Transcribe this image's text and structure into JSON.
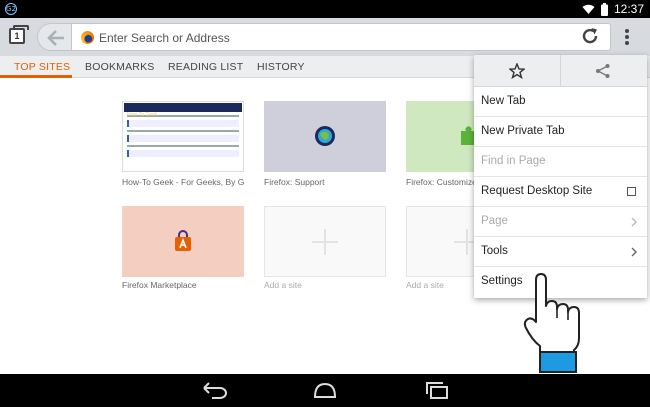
{
  "status": {
    "badge": "G2",
    "time": "12:37",
    "icons": [
      "wifi-icon",
      "battery-icon"
    ]
  },
  "toolbar": {
    "tabs_count": "1",
    "url_placeholder": "Enter Search or Address",
    "icons": [
      "tabs-icon",
      "back-icon",
      "firefox-icon",
      "reload-icon",
      "overflow-menu-icon"
    ]
  },
  "tabs": [
    {
      "label": "TOP SITES",
      "active": true
    },
    {
      "label": "BOOKMARKS",
      "active": false
    },
    {
      "label": "READING LIST",
      "active": false
    },
    {
      "label": "HISTORY",
      "active": false
    }
  ],
  "tiles": [
    {
      "label": "How-To Geek - For Geeks, By Geek",
      "thumb": "htg",
      "thumb_title": "How-To Geek"
    },
    {
      "label": "Firefox: Support",
      "thumb": "support"
    },
    {
      "label": "Firefox: Customize",
      "thumb": "customize"
    },
    {
      "label": "Firefox Marketplace",
      "thumb": "marketplace"
    },
    {
      "label": "Add a site",
      "thumb": "empty"
    },
    {
      "label": "Add a site",
      "thumb": "empty"
    }
  ],
  "menu": {
    "top_icons": [
      "star-icon",
      "share-icon"
    ],
    "items": [
      {
        "label": "New Tab",
        "enabled": true
      },
      {
        "label": "New Private Tab",
        "enabled": true
      },
      {
        "label": "Find in Page",
        "enabled": false
      },
      {
        "label": "Request Desktop Site",
        "enabled": true,
        "checkbox": false
      },
      {
        "label": "Page",
        "enabled": false,
        "submenu": true
      },
      {
        "label": "Tools",
        "enabled": true,
        "submenu": true
      },
      {
        "label": "Settings",
        "enabled": true
      }
    ]
  },
  "navbar": {
    "icons": [
      "back-nav-icon",
      "home-nav-icon",
      "recents-nav-icon"
    ]
  },
  "colors": {
    "accent": "#e66000",
    "toolbar": "#d7dade",
    "hand_cuff": "#1e9ae0"
  }
}
